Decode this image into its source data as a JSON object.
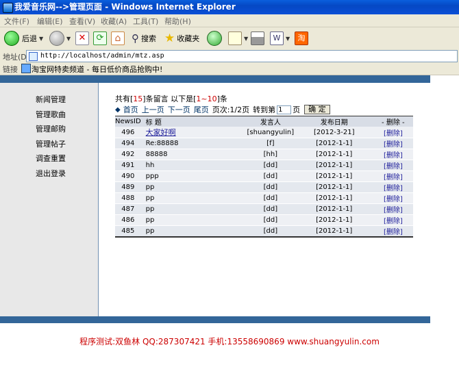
{
  "window": {
    "title": "我爱音乐网-->管理页面 - Windows Internet Explorer"
  },
  "menu": [
    "文件(F)",
    "编辑(E)",
    "查看(V)",
    "收藏(A)",
    "工具(T)",
    "帮助(H)"
  ],
  "toolbar": {
    "back_label": "后退",
    "search_label": "搜索",
    "favorites_label": "收藏夹"
  },
  "address": {
    "label": "地址(D)",
    "url": "http://localhost/admin/mtz.asp"
  },
  "links": {
    "label": "链接",
    "item": "淘宝网特卖频道 - 每日低价商品抢购中!"
  },
  "sidebar": {
    "items": [
      "新闻管理",
      "管理歌曲",
      "管理邮购",
      "管理帖子",
      "调查重置",
      "退出登录"
    ]
  },
  "summary": {
    "prefix": "共有[",
    "total": "15",
    "middle": "]条留言 以下是[",
    "range": "1~10",
    "suffix": "]条"
  },
  "pager": {
    "first": "首页",
    "prev": "上一页",
    "next": "下一页",
    "last": "尾页",
    "page_info": "页次:1/2页",
    "goto_label": "转到第",
    "goto_value": "1",
    "page_suffix": "页",
    "confirm": "确 定"
  },
  "table": {
    "headers": [
      "NewsID",
      "标 题",
      "发言人",
      "发布日期",
      "- 删除 -"
    ],
    "rows": [
      {
        "id": "496",
        "title": "大家好啊",
        "author": "[shuangyulin]",
        "date": "[2012-3-21]",
        "del": "[删除]"
      },
      {
        "id": "494",
        "title": "Re:88888",
        "author": "[f]",
        "date": "[2012-1-1]",
        "del": "[删除]"
      },
      {
        "id": "492",
        "title": "88888",
        "author": "[hh]",
        "date": "[2012-1-1]",
        "del": "[删除]"
      },
      {
        "id": "491",
        "title": "hh",
        "author": "[dd]",
        "date": "[2012-1-1]",
        "del": "[删除]"
      },
      {
        "id": "490",
        "title": "ppp",
        "author": "[dd]",
        "date": "[2012-1-1]",
        "del": "[删除]"
      },
      {
        "id": "489",
        "title": "pp",
        "author": "[dd]",
        "date": "[2012-1-1]",
        "del": "[删除]"
      },
      {
        "id": "488",
        "title": "pp",
        "author": "[dd]",
        "date": "[2012-1-1]",
        "del": "[删除]"
      },
      {
        "id": "487",
        "title": "pp",
        "author": "[dd]",
        "date": "[2012-1-1]",
        "del": "[删除]"
      },
      {
        "id": "486",
        "title": "pp",
        "author": "[dd]",
        "date": "[2012-1-1]",
        "del": "[删除]"
      },
      {
        "id": "485",
        "title": "pp",
        "author": "[dd]",
        "date": "[2012-1-1]",
        "del": "[删除]"
      }
    ]
  },
  "footer": {
    "text": "程序测试:双鱼林 QQ:287307421 手机:13558690869 www.shuangyulin.com"
  },
  "colors": {
    "band": "#336699",
    "title_bar": "#0a5fdd",
    "footer_text": "#cc0000"
  }
}
